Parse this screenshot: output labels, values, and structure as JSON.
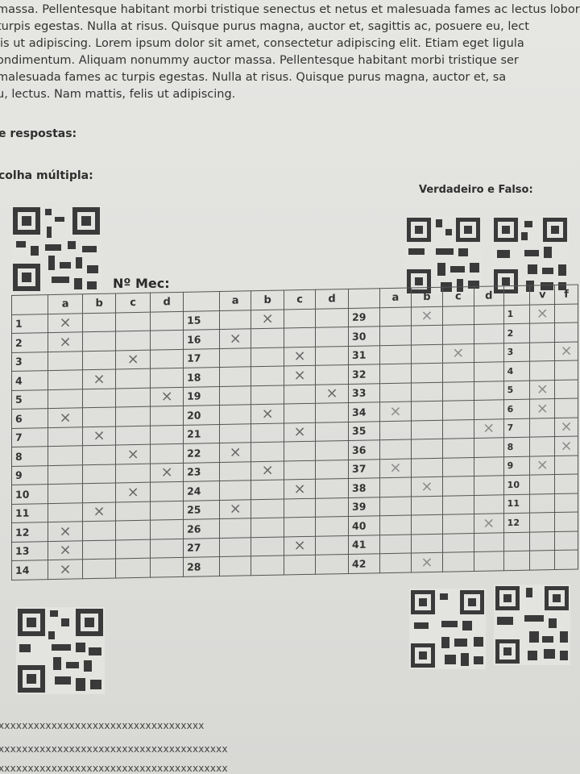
{
  "paragraph": [
    "massa. Pellentesque habitant morbi tristique senectus et netus et malesuada fames ac lectus lobortis condir",
    "turpis egestas. Nulla at risus. Quisque purus magna, auctor et, sagittis ac, posuere eu, lect",
    "lis ut adipiscing. Lorem ipsum dolor sit amet, consectetur adipiscing elit. Etiam eget ligula",
    "ondimentum. Aliquam nonummy auctor massa. Pellentesque habitant morbi tristique ser",
    "malesuada fames ac turpis egestas. Nulla at risus. Quisque purus magna, auctor et, sa",
    "u, lectus. Nam mattis, felis ut adipiscing."
  ],
  "headings": {
    "respostas": "e respostas:",
    "multipla": "colha múltipla:",
    "vf": "Verdadeiro e Falso:"
  },
  "mec_label": "Nº Mec:",
  "header_row": [
    "",
    "a",
    "b",
    "c",
    "d",
    "",
    "a",
    "b",
    "c",
    "d",
    "",
    "a",
    "b",
    "c",
    "d",
    "",
    "v",
    "f"
  ],
  "mark": "×",
  "rows": [
    [
      "1",
      "×",
      "",
      "",
      "",
      "15",
      "",
      "×",
      "",
      "",
      "29",
      "",
      "×",
      "",
      "",
      "1",
      "×",
      ""
    ],
    [
      "2",
      "×",
      "",
      "",
      "",
      "16",
      "×",
      "",
      "",
      "",
      "30",
      "",
      "",
      "",
      "",
      "2",
      "",
      ""
    ],
    [
      "3",
      "",
      "",
      "×",
      "",
      "17",
      "",
      "",
      "×",
      "",
      "31",
      "",
      "",
      "×",
      "",
      "3",
      "",
      "×"
    ],
    [
      "4",
      "",
      "×",
      "",
      "",
      "18",
      "",
      "",
      "×",
      "",
      "32",
      "",
      "",
      "",
      "",
      "4",
      "",
      ""
    ],
    [
      "5",
      "",
      "",
      "",
      "×",
      "19",
      "",
      "",
      "",
      "×",
      "33",
      "",
      "",
      "",
      "",
      "5",
      "×",
      ""
    ],
    [
      "6",
      "×",
      "",
      "",
      "",
      "20",
      "",
      "×",
      "",
      "",
      "34",
      "×",
      "",
      "",
      "",
      "6",
      "×",
      ""
    ],
    [
      "7",
      "",
      "×",
      "",
      "",
      "21",
      "",
      "",
      "×",
      "",
      "35",
      "",
      "",
      "",
      "×",
      "7",
      "",
      "×"
    ],
    [
      "8",
      "",
      "",
      "×",
      "",
      "22",
      "×",
      "",
      "",
      "",
      "36",
      "",
      "",
      "",
      "",
      "8",
      "",
      "×"
    ],
    [
      "9",
      "",
      "",
      "",
      "×",
      "23",
      "",
      "×",
      "",
      "",
      "37",
      "×",
      "",
      "",
      "",
      "9",
      "×",
      ""
    ],
    [
      "10",
      "",
      "",
      "×",
      "",
      "24",
      "",
      "",
      "×",
      "",
      "38",
      "",
      "×",
      "",
      "",
      "10",
      "",
      ""
    ],
    [
      "11",
      "",
      "×",
      "",
      "",
      "25",
      "×",
      "",
      "",
      "",
      "39",
      "",
      "",
      "",
      "",
      "11",
      "",
      ""
    ],
    [
      "12",
      "×",
      "",
      "",
      "",
      "26",
      "",
      "",
      "",
      "",
      "40",
      "",
      "",
      "",
      "×",
      "12",
      "",
      ""
    ],
    [
      "13",
      "×",
      "",
      "",
      "",
      "27",
      "",
      "",
      "×",
      "",
      "41",
      "",
      "",
      "",
      "",
      "",
      "",
      ""
    ],
    [
      "14",
      "×",
      "",
      "",
      "",
      "28",
      "",
      "",
      "",
      "",
      "42",
      "",
      "×",
      "",
      "",
      "",
      "",
      ""
    ]
  ],
  "footer_lines": [
    "xxxxxxxxxxxxxxxxxxxxxxxxxxxxxxxxxxx",
    "xxxxxxxxxxxxxxxxxxxxxxxxxxxxxxxxxxxxxxx",
    "xxxxxxxxxxxxxxxxxxxxxxxxxxxxxxxxxxxxxxx"
  ]
}
